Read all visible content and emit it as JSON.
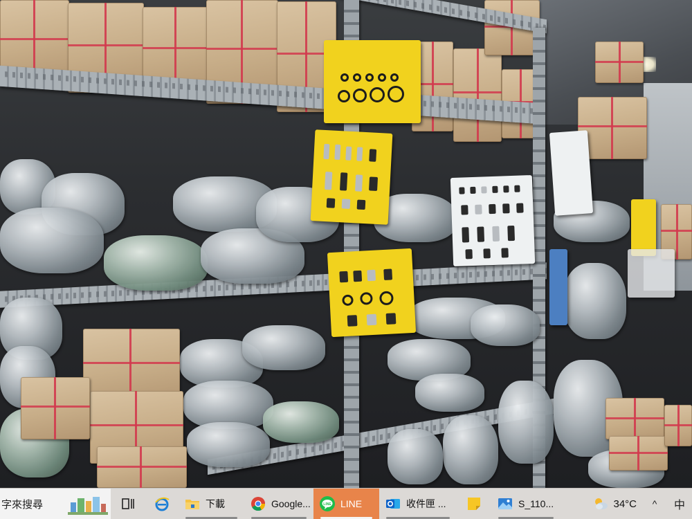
{
  "taskbar": {
    "search": {
      "placeholder": "字來搜尋"
    },
    "apps": [
      {
        "id": "task-view",
        "label": "",
        "icon": "task-view-icon"
      },
      {
        "id": "edge",
        "label": "",
        "icon": "internet-explorer-icon"
      },
      {
        "id": "explorer",
        "label": "下載",
        "icon": "folder-icon"
      },
      {
        "id": "chrome",
        "label": "Google...",
        "icon": "chrome-icon"
      },
      {
        "id": "line",
        "label": "LINE",
        "icon": "line-icon",
        "active": true
      },
      {
        "id": "outlook",
        "label": "收件匣 ...",
        "icon": "outlook-icon"
      },
      {
        "id": "sticky",
        "label": "",
        "icon": "sticky-notes-icon"
      },
      {
        "id": "photos",
        "label": "S_110...",
        "icon": "photos-icon"
      }
    ],
    "tray": {
      "temperature": "34°C",
      "weather_icon": "partly-cloudy-icon",
      "chevron": "^",
      "input_method": "中"
    },
    "colors": {
      "background": "#dcd9d6",
      "active_app": "#e8844a",
      "line_green": "#1fbd4a",
      "outlook_blue": "#0f62c7"
    }
  }
}
